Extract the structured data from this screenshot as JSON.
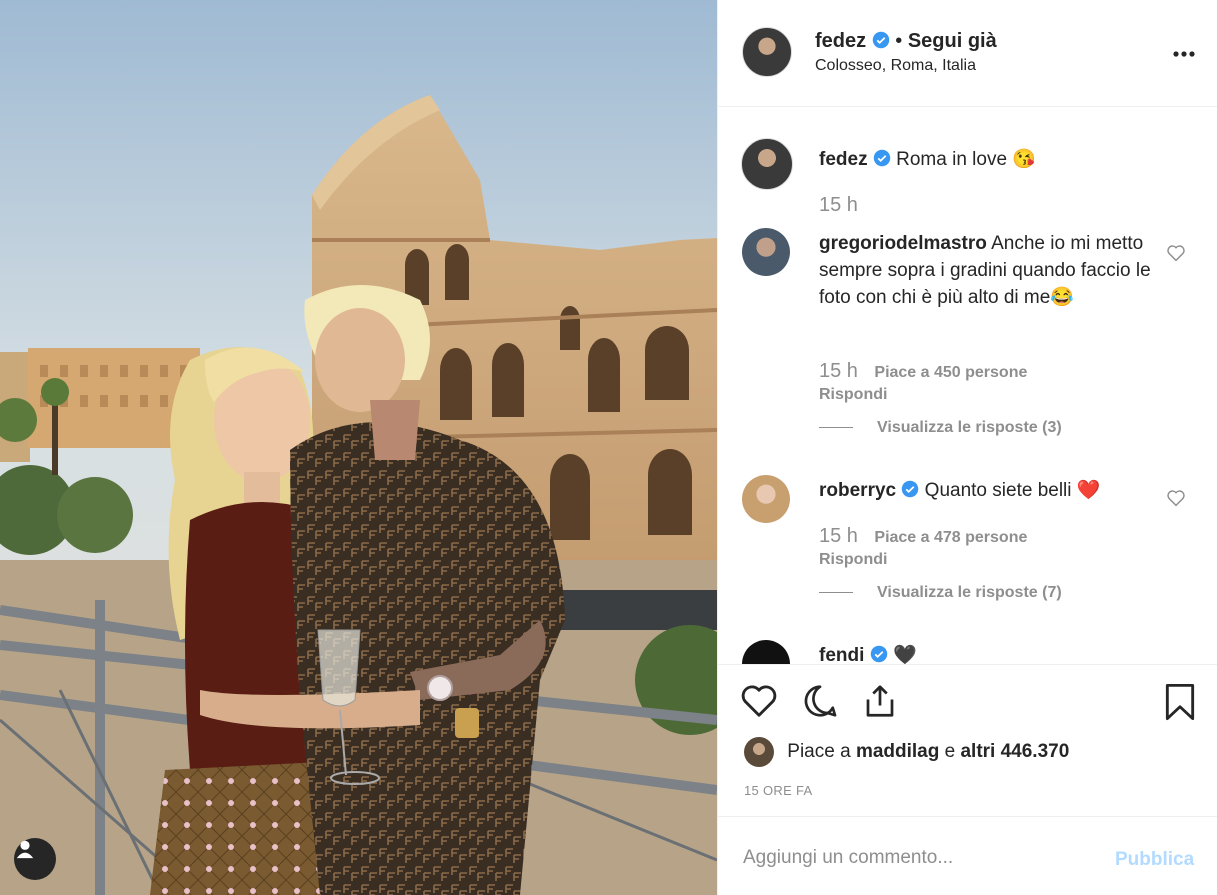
{
  "colors": {
    "verified": "#3897f0",
    "text": "#262626",
    "muted": "#8e8e8e",
    "publish_disabled": "#b3dbff",
    "emoji_heart": "#e0245e"
  },
  "header": {
    "username": "fedez",
    "separator": "•",
    "follow_status": "Segui già",
    "location": "Colosseo, Roma, Italia"
  },
  "caption": {
    "username": "fedez",
    "text": "Roma in love 😘",
    "time": "15 h"
  },
  "comments": [
    {
      "username": "gregoriodelmastro",
      "text": "Anche io mi metto sempre sopra i gradini quando faccio le foto con chi è più alto di me😂",
      "time": "15 h",
      "likes": "Piace a 450 persone",
      "reply": "Rispondi",
      "view_replies": "Visualizza le risposte (3)"
    },
    {
      "username": "roberryc",
      "text": "Quanto siete belli ❤️",
      "time": "15 h",
      "likes": "Piace a 478 persone",
      "reply": "Rispondi",
      "view_replies": "Visualizza le risposte (7)"
    },
    {
      "username": "fendi",
      "text": "🖤"
    }
  ],
  "likes": {
    "prefix": "Piace a",
    "user": "maddilag",
    "middle": "e",
    "others": "altri 446.370"
  },
  "timestamp": "15 ORE FA",
  "add_comment": {
    "placeholder": "Aggiungi un commento...",
    "publish_label": "Pubblica"
  },
  "icons": [
    "more-icon",
    "heart-icon",
    "comment-icon",
    "share-icon",
    "bookmark-icon",
    "verified-icon",
    "user-tag-icon"
  ]
}
